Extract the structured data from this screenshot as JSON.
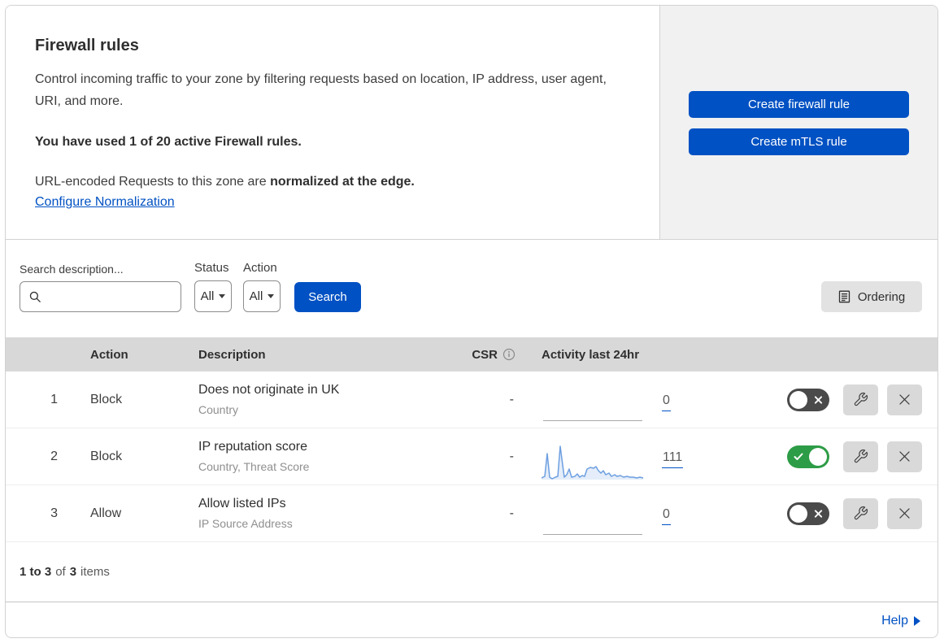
{
  "header": {
    "title": "Firewall rules",
    "description": "Control incoming traffic to your zone by filtering requests based on location, IP address, user agent, URI, and more.",
    "usage_notice": "You have used 1 of 20 active Firewall rules.",
    "normalization_prefix": "URL-encoded Requests to this zone are ",
    "normalization_bold": "normalized at the edge.",
    "configure_link": "Configure Normalization",
    "create_firewall_button": "Create firewall rule",
    "create_mtls_button": "Create mTLS rule"
  },
  "filters": {
    "search_label": "Search description...",
    "status_label": "Status",
    "status_value": "All",
    "action_label": "Action",
    "action_value": "All",
    "search_button": "Search",
    "ordering_button": "Ordering"
  },
  "table": {
    "headers": {
      "action": "Action",
      "description": "Description",
      "csr": "CSR",
      "activity": "Activity last 24hr"
    },
    "rows": [
      {
        "num": "1",
        "action": "Block",
        "description": "Does not originate in UK",
        "fields": "Country",
        "csr": "-",
        "activity_count": "0",
        "enabled": false
      },
      {
        "num": "2",
        "action": "Block",
        "description": "IP reputation score",
        "fields": "Country, Threat Score",
        "csr": "-",
        "activity_count": "111",
        "enabled": true
      },
      {
        "num": "3",
        "action": "Allow",
        "description": "Allow listed IPs",
        "fields": "IP Source Address",
        "csr": "-",
        "activity_count": "0",
        "enabled": false
      }
    ],
    "footer": {
      "range": "1 to 3",
      "of": "of",
      "total": "3",
      "items": "items"
    }
  },
  "help": {
    "label": "Help"
  },
  "colors": {
    "accent_blue": "#0051c3",
    "toggle_on_green": "#2d9c46",
    "toggle_off_gray": "#4a4a4a",
    "sparkline_blue": "#6d9fe0",
    "sparkline_fill": "#e4edf9",
    "panel_gray": "#f1f1f1",
    "table_header_gray": "#d8d8d8"
  },
  "icons": {
    "search": "search-icon",
    "caret": "chevron-down-icon",
    "ordering": "list-icon",
    "info": "info-icon",
    "wrench": "wrench-icon",
    "close": "close-icon",
    "help_arrow": "arrow-right-icon"
  }
}
